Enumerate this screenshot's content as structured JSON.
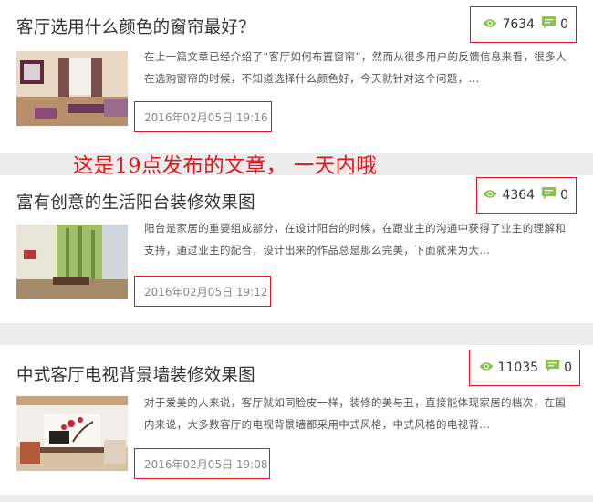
{
  "annotation": {
    "text": "这是19点发布的文章，  一天内哦",
    "color": "#e3141c"
  },
  "colors": {
    "highlight_border": "#e3141c",
    "icon_green": "#8cc152",
    "divider": "#ececec"
  },
  "articles": [
    {
      "title": "客厅选用什么颜色的窗帘最好？",
      "views": "7634",
      "comments": "0",
      "excerpt": "在上一篇文章已经介绍了“客厅如何布置窗帘”，然而从很多用户的反馈信息来看，很多人在选购窗帘的时候，不知道选择什么颜色好，今天就针对这个问题，...",
      "date": "2016年02月05日 19:16",
      "thumb_icon": "living-room-curtain-photo"
    },
    {
      "title": "富有创意的生活阳台装修效果图",
      "views": "4364",
      "comments": "0",
      "excerpt": "阳台是家居的重要组成部分，在设计阳台的时候，在跟业主的沟通中获得了业主的理解和支持，通过业主的配合，设计出来的作品总是那么完美，下面就来为大...",
      "date": "2016年02月05日 19:12",
      "thumb_icon": "balcony-photo"
    },
    {
      "title": "中式客厅电视背景墙装修效果图",
      "views": "11035",
      "comments": "0",
      "excerpt": "对于爱美的人来说，客厅就如同脸皮一样，装修的美与丑，直接能体现家居的档次，在国内来说，大多数客厅的电视背景墙都采用中式风格，中式风格的电视背...",
      "date": "2016年02月05日 19:08",
      "thumb_icon": "chinese-tv-wall-photo"
    }
  ],
  "icons": {
    "views": "eye-icon",
    "comments": "comment-icon"
  }
}
